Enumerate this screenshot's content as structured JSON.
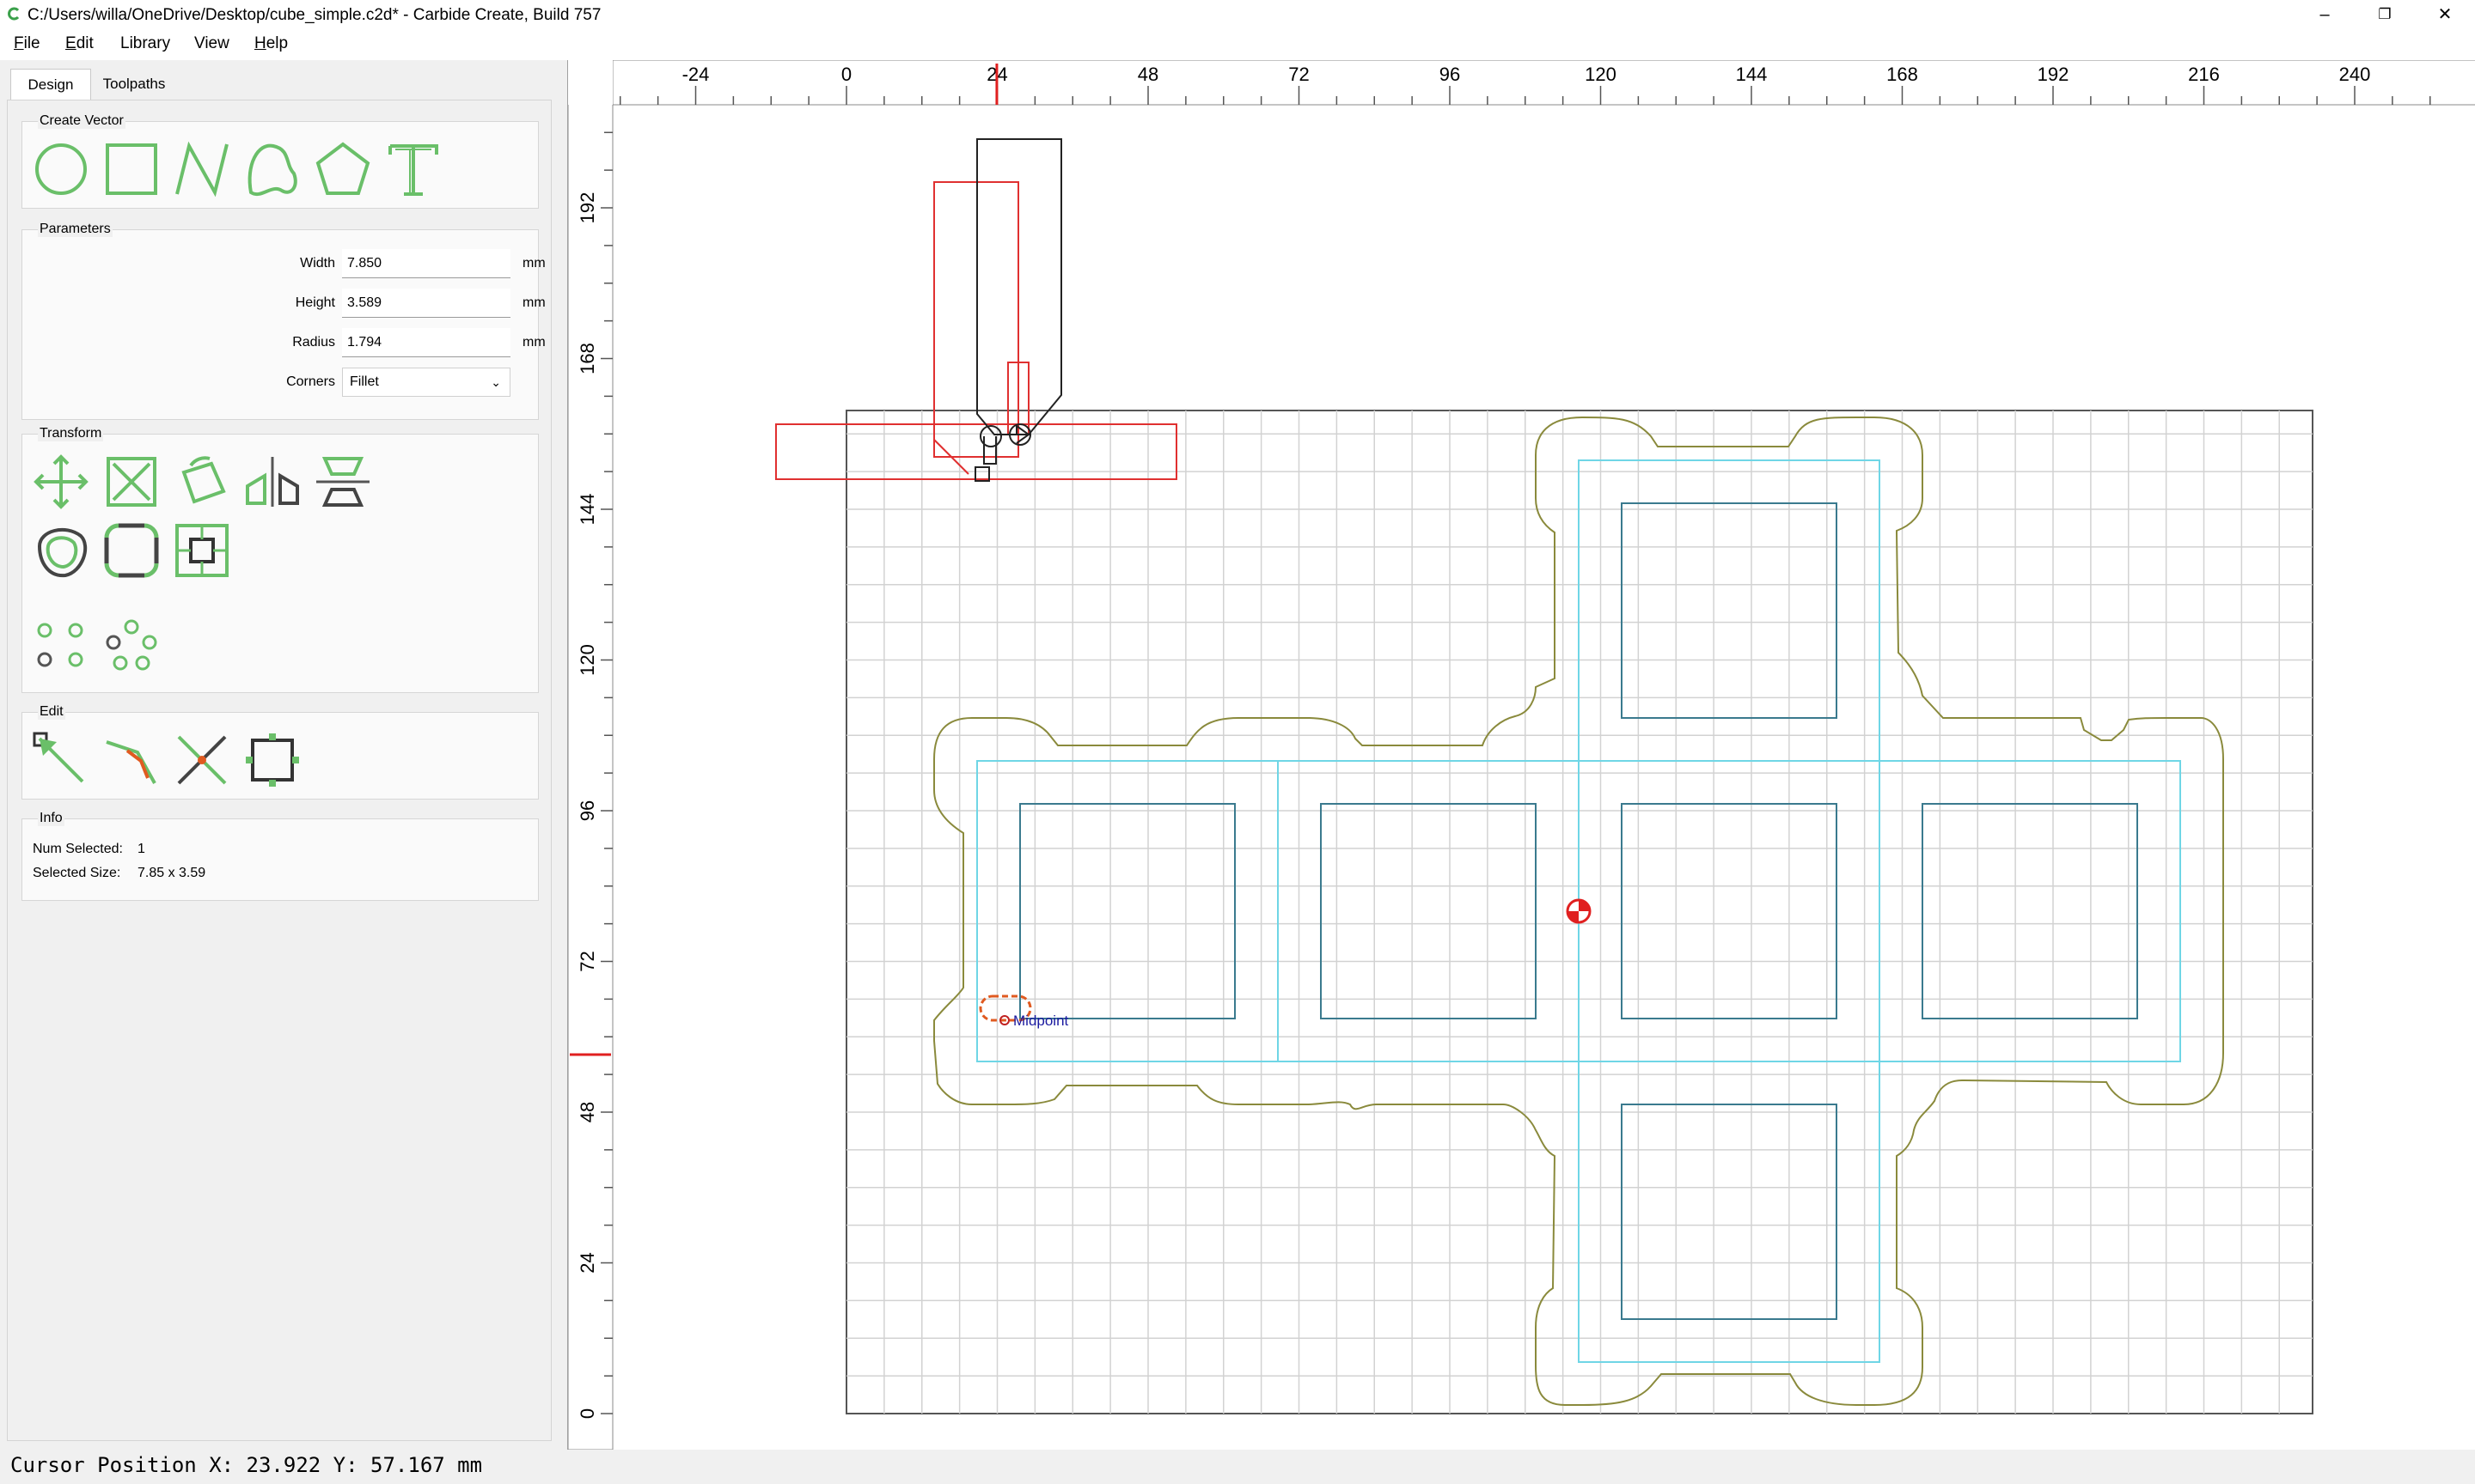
{
  "window": {
    "title": "C:/Users/willa/OneDrive/Desktop/cube_simple.c2d* - Carbide Create, Build 757",
    "minimize": "–",
    "restore": "❐",
    "close": "✕"
  },
  "menu": [
    {
      "label": "File",
      "underline": "F",
      "rest": "ile"
    },
    {
      "label": "Edit",
      "underline": "E",
      "rest": "dit"
    },
    {
      "label": "Library",
      "underline": "",
      "rest": "Library"
    },
    {
      "label": "View",
      "underline": "",
      "rest": "View"
    },
    {
      "label": "Help",
      "underline": "H",
      "rest": "elp"
    }
  ],
  "tabs": {
    "design": "Design",
    "toolpaths": "Toolpaths"
  },
  "create_vector": {
    "title": "Create Vector",
    "tools": [
      "circle-icon",
      "rectangle-icon",
      "polyline-icon",
      "curve-icon",
      "polygon-icon",
      "text-icon"
    ]
  },
  "parameters": {
    "title": "Parameters",
    "width_label": "Width",
    "width_value": "7.850",
    "height_label": "Height",
    "height_value": "3.589",
    "radius_label": "Radius",
    "radius_value": "1.794",
    "unit": "mm",
    "corners_label": "Corners",
    "corners_value": "Fillet"
  },
  "transform": {
    "title": "Transform",
    "tools": [
      "move-icon",
      "scale-icon",
      "rotate-icon",
      "mirror-icon",
      "flip-icon",
      "offset-icon",
      "fillet-icon",
      "boolean-icon",
      "linear-array-icon",
      "circular-array-icon"
    ]
  },
  "edit": {
    "title": "Edit",
    "tools": [
      "node-edit-icon",
      "trim-icon",
      "cut-icon",
      "bounding-box-icon"
    ]
  },
  "info": {
    "title": "Info",
    "num_selected_label": "Num Selected:",
    "num_selected_value": "1",
    "size_label": "Selected Size:",
    "size_value": "7.85 x 3.59"
  },
  "status": {
    "cursor": "Cursor Position X: 23.922 Y: 57.167 mm"
  },
  "rulers": {
    "x_ticks": [
      "-24",
      "0",
      "24",
      "48",
      "72",
      "96",
      "120",
      "144",
      "168",
      "192",
      "216",
      "240"
    ],
    "y_ticks": [
      "192",
      "168",
      "144",
      "120",
      "96",
      "72",
      "48",
      "24",
      "0"
    ],
    "cursor_x": 23.922,
    "cursor_y": 57.167
  },
  "canvas": {
    "midpoint_label": "Midpoint",
    "colors": {
      "outline": "#8a8a3c",
      "inner_cyan": "#6fd6e6",
      "faces": "#3a7a8e",
      "selected": "#e03030",
      "tool": "#222222",
      "grid": "#d2d2d2"
    }
  }
}
